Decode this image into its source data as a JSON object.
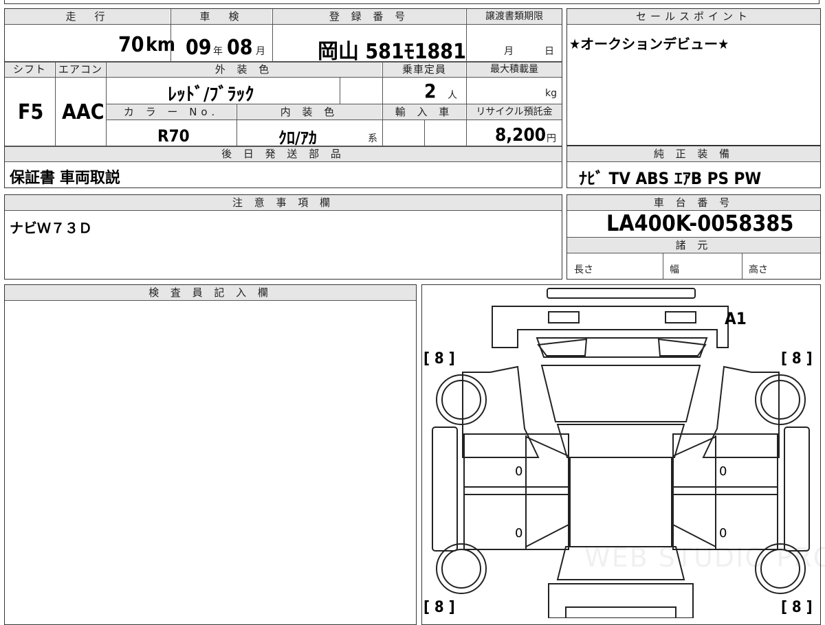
{
  "top": {
    "mileage_header": "走　行",
    "inspection_header": "車　検",
    "registration_header": "登 録 番 号",
    "transfer_header": "譲渡書類期限",
    "mileage_value": "70",
    "mileage_unit": "km",
    "inspection_year": "09",
    "year_unit": "年",
    "inspection_month": "08",
    "month_unit": "月",
    "registration_value": "岡山 581ﾓ1881",
    "transfer_month_unit": "月",
    "transfer_day_unit": "日",
    "shift_header": "シフト",
    "aircon_header": "エアコン",
    "exterior_color_header": "外 装 色",
    "capacity_header": "乗車定員",
    "max_load_header": "最大積載量",
    "shift_value": "F5",
    "aircon_value": "AAC",
    "exterior_color_value": "ﾚｯﾄﾞ/ﾌﾞﾗｯｸ",
    "capacity_value": "2",
    "capacity_unit": "人",
    "max_load_unit": "kg",
    "color_no_header": "カ ラ ー No.",
    "interior_color_header": "内 装 色",
    "import_header": "輸 入 車",
    "recycle_header": "リサイクル預託金",
    "color_no_value": "R70",
    "interior_color_value": "ｸﾛ/ｱｶ",
    "interior_suffix": "系",
    "recycle_value": "8,200",
    "recycle_unit": "円",
    "later_parts_header": "後 日 発 送 部 品",
    "later_parts_value": "保証書 車両取説"
  },
  "sales": {
    "header": "セールスポイント",
    "text": "★オークションデビュー★"
  },
  "equipment": {
    "header": "純 正 装 備",
    "value": "ﾅﾋﾞ  TV  ABS ｴｱB PS PW"
  },
  "notes": {
    "header": "注 意 事 項 欄",
    "text": "ナビＷ７３Ｄ"
  },
  "chassis": {
    "header": "車 台 番 号",
    "value": "LA400K-0058385"
  },
  "specs": {
    "header": "諸 元",
    "length_label": "長さ",
    "width_label": "幅",
    "height_label": "高さ"
  },
  "inspector": {
    "header": "検 査 員 記 入 欄"
  },
  "diagram": {
    "grade": "A1",
    "tread_fl": "[ 8 ]",
    "tread_fr": "[ 8 ]",
    "tread_rl": "[ 8 ]",
    "tread_rr": "[ 8 ]",
    "panel_left_front": "0",
    "panel_left_rear": "0",
    "panel_right_front": "0",
    "panel_right_rear": "0",
    "watermark": "WEB STUDIO PRO"
  }
}
